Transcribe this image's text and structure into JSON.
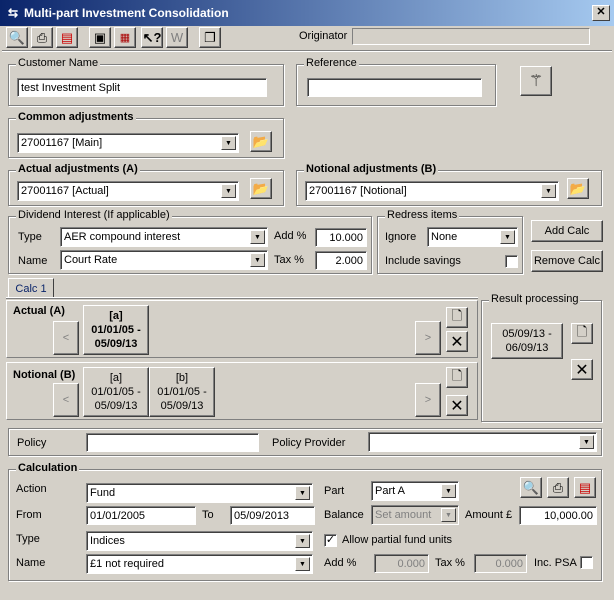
{
  "window": {
    "title": "Multi-part Investment Consolidation"
  },
  "toolbar": {
    "originator_label": "Originator",
    "originator_value": ""
  },
  "customer": {
    "legend": "Customer Name",
    "value": "test Investment Split"
  },
  "reference": {
    "legend": "Reference",
    "value": ""
  },
  "common_adjustments": {
    "legend": "Common adjustments",
    "value": "27001167 [Main]"
  },
  "actual_adjustments": {
    "legend": "Actual adjustments (A)",
    "value": "27001167 [Actual]"
  },
  "notional_adjustments": {
    "legend": "Notional adjustments (B)",
    "value": "27001167 [Notional]"
  },
  "dividend": {
    "legend": "Dividend Interest (If applicable)",
    "type_label": "Type",
    "type_value": "AER compound interest",
    "name_label": "Name",
    "name_value": "Court Rate",
    "add_label": "Add %",
    "add_value": "10.000",
    "tax_label": "Tax %",
    "tax_value": "2.000"
  },
  "redress": {
    "legend": "Redress items",
    "ignore_label": "Ignore",
    "ignore_value": "None",
    "include_label": "Include savings"
  },
  "buttons": {
    "add_calc": "Add Calc",
    "remove_calc": "Remove Calc"
  },
  "tabs": [
    {
      "label": "Calc 1"
    }
  ],
  "calc": {
    "actual_label": "Actual (A)",
    "notional_label": "Notional (B)",
    "prev": "<",
    "next": ">",
    "actual_parts": [
      {
        "tag": "[a]",
        "dates": "01/01/05 -",
        "dates2": "05/09/13"
      }
    ],
    "notional_parts": [
      {
        "tag": "[a]",
        "dates": "01/01/05 -",
        "dates2": "05/09/13"
      },
      {
        "tag": "[b]",
        "dates": "01/01/05 -",
        "dates2": "05/09/13"
      }
    ]
  },
  "result": {
    "legend": "Result processing",
    "line1": "05/09/13 -",
    "line2": "06/09/13"
  },
  "policy": {
    "policy_label": "Policy",
    "policy_value": "",
    "provider_label": "Policy Provider",
    "provider_value": ""
  },
  "calculation": {
    "legend": "Calculation",
    "action_label": "Action",
    "action_value": "Fund",
    "part_label": "Part",
    "part_value": "Part A",
    "from_label": "From",
    "from_value": "01/01/2005",
    "to_label": "To",
    "to_value": "05/09/2013",
    "balance_label": "Balance",
    "balance_value": "Set amount",
    "amount_label": "Amount £",
    "amount_value": "10,000.00",
    "type_label": "Type",
    "type_value": "Indices",
    "allow_label": "Allow partial fund units",
    "name_label": "Name",
    "name_value": "£1 not required",
    "add_label": "Add %",
    "add_value": "0.000",
    "tax_label": "Tax %",
    "tax_value": "0.000",
    "psa_label": "Inc. PSA"
  }
}
